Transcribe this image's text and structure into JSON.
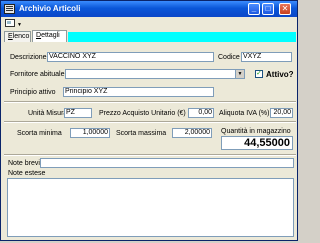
{
  "window": {
    "title": "Archivio Articoli",
    "min": "_",
    "max": "□",
    "close": "✕"
  },
  "tabs": [
    {
      "label_first": "E",
      "label_rest": "lenco"
    },
    {
      "label_first": "D",
      "label_rest": "ettagli"
    }
  ],
  "form": {
    "descrizione_label": "Descrizione",
    "descrizione_value": "VACCINO XYZ",
    "codice_label": "Codice",
    "codice_value": "VXYZ",
    "fornitore_label": "Fornitore abituale",
    "fornitore_value": "",
    "attivo_label": "Attivo?",
    "attivo_checked": true,
    "principio_label": "Principio attivo",
    "principio_value": "Principio XYZ",
    "unita_label": "Unità Misura",
    "unita_value": "PZ",
    "prezzo_label": "Prezzo Acquisto Unitario (€)",
    "prezzo_value": "0,00",
    "aliquota_label": "Aliquota IVA (%)",
    "aliquota_value": "20,00",
    "scorta_min_label": "Scorta minima",
    "scorta_min_value": "1,00000",
    "scorta_max_label": "Scorta massima",
    "scorta_max_value": "2,00000",
    "qta_label": "Quantità in magazzino",
    "qta_value": "44,55000",
    "note_brevi_label": "Note brevi",
    "note_brevi_value": "",
    "note_estese_label": "Note estese",
    "note_estese_value": ""
  },
  "colors": {
    "titlebar": "#0a46c8",
    "tab_fill": "#00ffff",
    "check": "#21a121"
  }
}
